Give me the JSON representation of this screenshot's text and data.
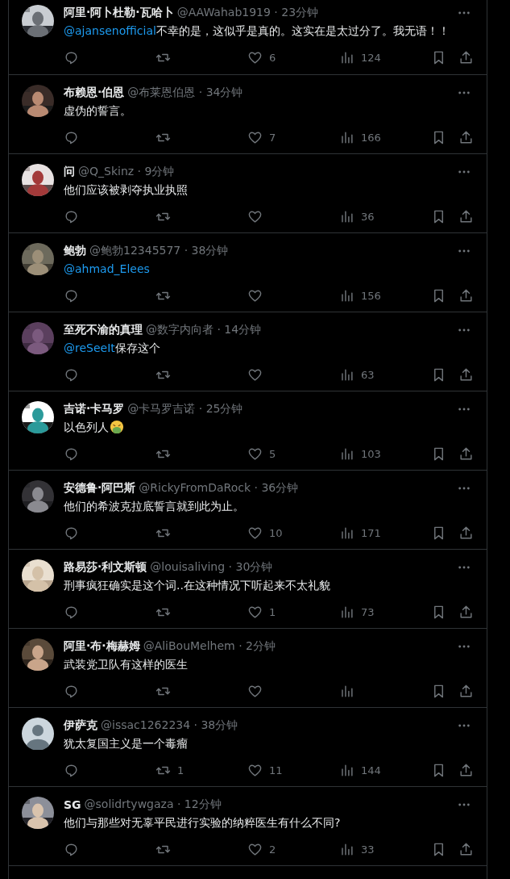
{
  "replies": [
    {
      "name": "阿里·阿卜杜勒·瓦哈卜",
      "byline": "@AAWahab1919 · 23分钟",
      "mention": "@ajansenofficial",
      "text": "不幸的是，这似乎是真的。这实在是太过分了。我无语！！",
      "likes": "6",
      "views": "124"
    },
    {
      "name": "布赖恩·伯恩",
      "byline": "@布莱恩伯恩 · 34分钟",
      "text": "虚伪的誓言。",
      "likes": "7",
      "views": "166"
    },
    {
      "name": "问",
      "byline": "@Q_Skinz · 9分钟",
      "text": "他们应该被剥夺执业执照",
      "views": "36"
    },
    {
      "name": "鲍勃",
      "byline": "@鲍勃12345577 · 38分钟",
      "mention": "@ahmad_Elees",
      "views": "156"
    },
    {
      "name": "至死不渝的真理",
      "byline": "@数字内向者 · 14分钟",
      "mention": "@reSeeIt",
      "text": "保存这个",
      "views": "63"
    },
    {
      "name": "吉诺·卡马罗",
      "byline": "@卡马罗吉诺 · 25分钟",
      "text": "以色列人",
      "emoji": true,
      "likes": "5",
      "views": "103"
    },
    {
      "name": "安德鲁·阿巴斯",
      "byline": "@RickyFromDaRock · 36分钟",
      "text": "他们的希波克拉底誓言就到此为止。",
      "likes": "10",
      "views": "171"
    },
    {
      "name": "路易莎·利文斯顿",
      "byline": "@louisaliving · 30分钟",
      "text": "刑事疯狂确实是这个词..在这种情况下听起来不太礼貌",
      "likes": "1",
      "views": "73"
    },
    {
      "name": "阿里·布·梅赫姆",
      "byline": "@AliBouMelhem · 2分钟",
      "text": "武装党卫队有这样的医生"
    },
    {
      "name": "伊萨克",
      "byline": "@issac1262234 · 38分钟",
      "avatar": {
        "kind": "default"
      },
      "text": "犹太复国主义是一个毒瘤",
      "retweets": "1",
      "likes": "11",
      "views": "144"
    },
    {
      "name": "SG",
      "byline": "@solidrtywgaza · 12分钟",
      "text": "他们与那些对无辜平民进行实验的纳粹医生有什么不同?",
      "likes": "2",
      "views": "33"
    }
  ]
}
